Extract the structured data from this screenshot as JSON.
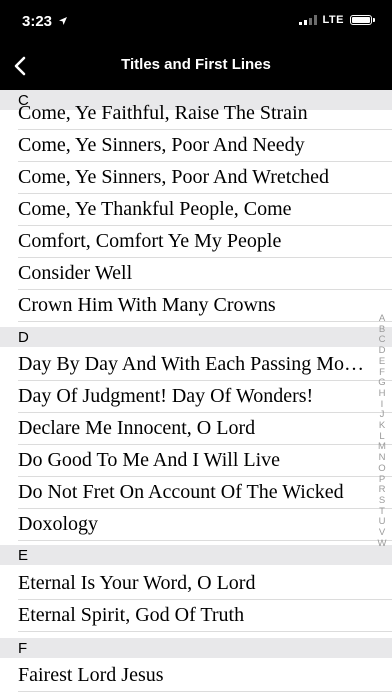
{
  "status_bar": {
    "time": "3:23",
    "network": "LTE"
  },
  "nav": {
    "title": "Titles and First Lines"
  },
  "sections": [
    {
      "letter": "C",
      "items": [
        "Come, Ye Faithful, Raise The Strain",
        "Come, Ye Sinners, Poor And Needy",
        "Come, Ye Sinners, Poor And Wretched",
        "Come, Ye Thankful People, Come",
        "Comfort, Comfort Ye My People",
        "Consider Well",
        "Crown Him With Many Crowns"
      ]
    },
    {
      "letter": "D",
      "items": [
        "Day By Day And With Each Passing Moment",
        "Day Of Judgment! Day Of Wonders!",
        "Declare Me Innocent, O Lord",
        "Do Good To Me And I Will Live",
        "Do Not Fret On Account Of The Wicked",
        "Doxology"
      ]
    },
    {
      "letter": "E",
      "items": [
        "Eternal Is Your Word, O Lord",
        "Eternal Spirit, God Of Truth"
      ]
    },
    {
      "letter": "F",
      "items": [
        "Fairest Lord Jesus"
      ]
    }
  ],
  "index_letters": [
    "A",
    "B",
    "C",
    "D",
    "E",
    "F",
    "G",
    "H",
    "I",
    "J",
    "K",
    "L",
    "M",
    "N",
    "O",
    "P",
    "R",
    "S",
    "T",
    "U",
    "V",
    "W"
  ]
}
